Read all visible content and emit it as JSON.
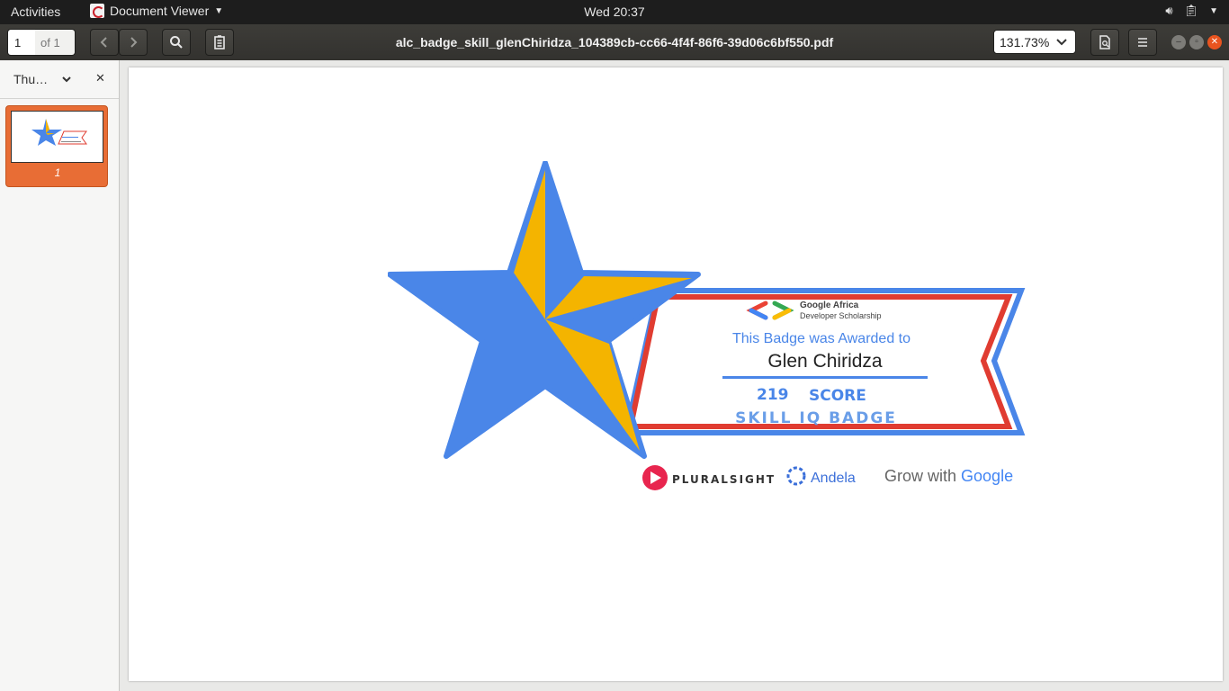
{
  "topbar": {
    "activities": "Activities",
    "app_name": "Document Viewer",
    "clock": "Wed 20:37"
  },
  "header": {
    "current_page": "1",
    "page_of": "of 1",
    "title": "alc_badge_skill_glenChiridza_104389cb-cc66-4f4f-86f6-39d06c6bf550.pdf",
    "zoom": "131.73%"
  },
  "sidebar": {
    "mode_label": "Thu…",
    "thumbnails": [
      {
        "page_label": "1"
      }
    ]
  },
  "badge": {
    "org_line1": "Google Africa",
    "org_line2": "Developer Scholarship",
    "awarded_text": "This Badge was Awarded to",
    "recipient": "Glen Chiridza",
    "score_value": "219",
    "score_label": "SCORE",
    "badge_type": "SKILL IQ BADGE",
    "sponsor_1": "PLURALSIGHT",
    "sponsor_2": "Andela",
    "sponsor_3_prefix": "Grow with ",
    "sponsor_3_brand": "Google"
  },
  "colors": {
    "star_blue": "#4a86e8",
    "star_yellow": "#f4b400",
    "ribbon_red": "#e03c31",
    "text_blue": "#4a86e8",
    "accent_orange": "#e86d35"
  }
}
